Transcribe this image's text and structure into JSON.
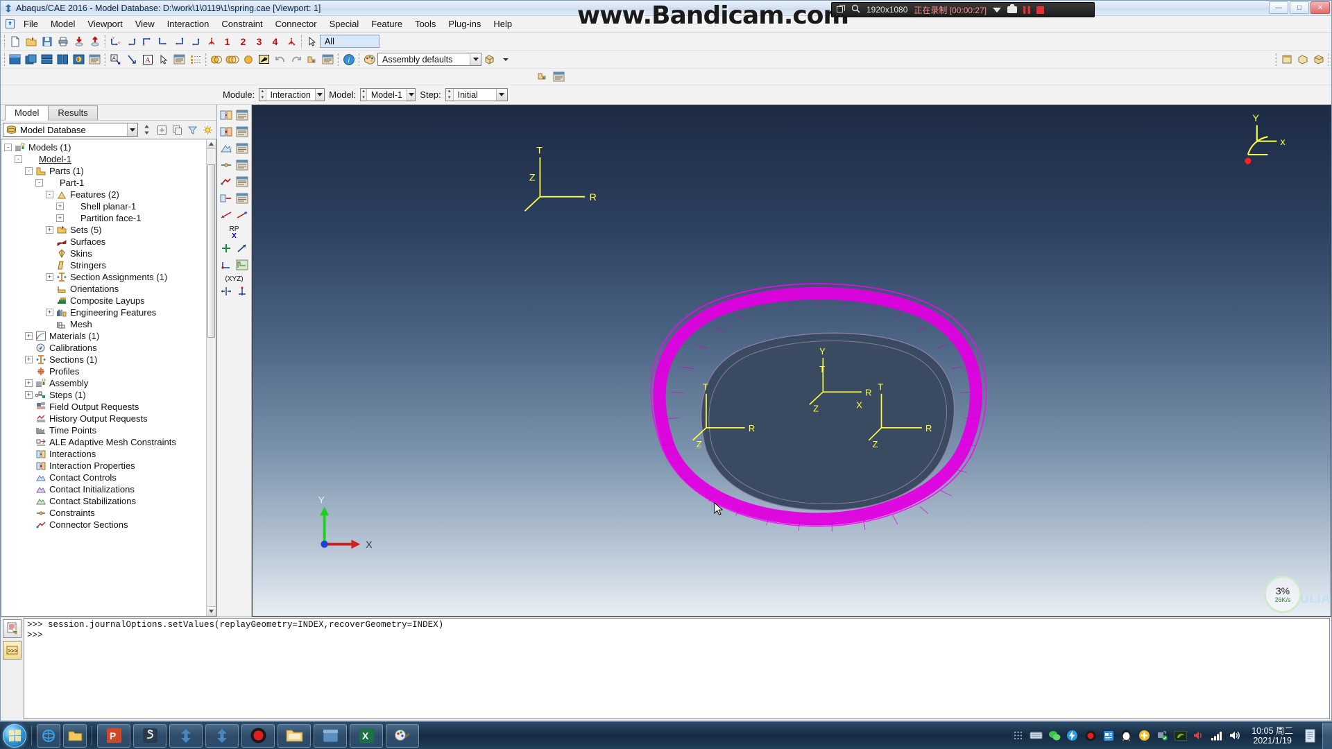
{
  "window": {
    "title": "Abaqus/CAE 2016 - Model Database: D:\\work\\1\\0119\\1\\spring.cae [Viewport: 1]",
    "minimize_label": "—",
    "maximize_label": "□",
    "close_label": "✕"
  },
  "watermark": {
    "text": "www.Bandicam.com"
  },
  "recorder": {
    "resolution": "1920x1080",
    "status": "正在录制 [00:00:27]",
    "expand_icon": "expand-icon",
    "zoom_icon": "magnifier-icon",
    "dropdown_icon": "chevron-down-icon",
    "camera_icon": "camera-icon",
    "pause_icon": "pause-icon",
    "stop_icon": "stop-icon"
  },
  "menubar": {
    "app_icon": "abaqus-menu-icon",
    "items": [
      "File",
      "Model",
      "Viewport",
      "View",
      "Interaction",
      "Constraint",
      "Connector",
      "Special",
      "Feature",
      "Tools",
      "Plug-ins",
      "Help"
    ]
  },
  "toolbar_row1": {
    "file_group": [
      "new-file-icon",
      "open-file-icon",
      "save-model-icon",
      "print-icon",
      "import-icon",
      "export-icon"
    ],
    "view_group": [
      "view-front-icon",
      "view-back-icon",
      "view-top-icon",
      "view-bottom-icon",
      "view-left-icon",
      "view-right-icon",
      "view-iso-icon"
    ],
    "view_numbers": [
      "1",
      "2",
      "3",
      "4"
    ],
    "apply_view_icon": "apply-view-icon",
    "selection_icon": "selection-arrow-icon",
    "selection_filter_value": "All"
  },
  "toolbar_row2": {
    "viewport_group": [
      "viewport-create-icon",
      "viewport-tile-icon",
      "viewport-horizontal-icon",
      "viewport-vertical-icon",
      "viewport-cycle-icon",
      "viewport-annotate-icon"
    ],
    "annotation_group": [
      "text-annotation-icon",
      "arrow-annotation-icon",
      "text-style-icon",
      "select-annotation-icon",
      "viewport-options-icon",
      "list-annotation-icon"
    ],
    "render_group": [
      "wireframe-icon",
      "hidden-line-icon",
      "shaded-icon",
      "render-beam-icon",
      "undo-view-icon",
      "redo-view-icon",
      "part-display-icon",
      "assembly-display-icon"
    ],
    "info_icon": "info-icon",
    "color_icon": "color-palette-icon",
    "color_code_value": "Assembly defaults",
    "cube_icon": "render-cube-icon",
    "right_group": [
      "plugin-1-icon",
      "plugin-2-icon",
      "plugin-3-icon"
    ]
  },
  "toolbar_row3": {
    "icons": [
      "query-icon",
      "probe-icon"
    ]
  },
  "context": {
    "module_label": "Module:",
    "module_value": "Interaction",
    "model_label": "Model:",
    "model_value": "Model-1",
    "step_label": "Step:",
    "step_value": "Initial"
  },
  "left_panel": {
    "tabs": [
      {
        "label": "Model",
        "active": true
      },
      {
        "label": "Results",
        "active": false
      }
    ],
    "database_selector": {
      "icon": "database-icon",
      "value": "Model Database"
    },
    "panel_buttons": [
      "spinner-icon",
      "create-icon",
      "copy-icon",
      "filter-icon",
      "highlight-icon"
    ],
    "tree": [
      {
        "label": "Models (1)",
        "indent": 0,
        "expander": "-",
        "icon": "models-icon"
      },
      {
        "label": "Model-1",
        "indent": 1,
        "expander": "-",
        "icon": "none",
        "underline": true
      },
      {
        "label": "Parts (1)",
        "indent": 2,
        "expander": "-",
        "icon": "parts-icon"
      },
      {
        "label": "Part-1",
        "indent": 3,
        "expander": "-",
        "icon": "none"
      },
      {
        "label": "Features (2)",
        "indent": 4,
        "expander": "-",
        "icon": "features-icon"
      },
      {
        "label": "Shell planar-1",
        "indent": 5,
        "expander": "+",
        "icon": "none"
      },
      {
        "label": "Partition face-1",
        "indent": 5,
        "expander": "+",
        "icon": "none"
      },
      {
        "label": "Sets (5)",
        "indent": 4,
        "expander": "+",
        "icon": "sets-icon"
      },
      {
        "label": "Surfaces",
        "indent": 4,
        "expander": "",
        "icon": "surfaces-icon"
      },
      {
        "label": "Skins",
        "indent": 4,
        "expander": "",
        "icon": "skins-icon"
      },
      {
        "label": "Stringers",
        "indent": 4,
        "expander": "",
        "icon": "stringers-icon"
      },
      {
        "label": "Section Assignments (1)",
        "indent": 4,
        "expander": "+",
        "icon": "section-assignments-icon"
      },
      {
        "label": "Orientations",
        "indent": 4,
        "expander": "",
        "icon": "orientations-icon"
      },
      {
        "label": "Composite Layups",
        "indent": 4,
        "expander": "",
        "icon": "composite-layups-icon"
      },
      {
        "label": "Engineering Features",
        "indent": 4,
        "expander": "+",
        "icon": "engineering-features-icon"
      },
      {
        "label": "Mesh",
        "indent": 4,
        "expander": "",
        "icon": "mesh-icon"
      },
      {
        "label": "Materials (1)",
        "indent": 2,
        "expander": "+",
        "icon": "materials-icon"
      },
      {
        "label": "Calibrations",
        "indent": 2,
        "expander": "",
        "icon": "calibrations-icon"
      },
      {
        "label": "Sections (1)",
        "indent": 2,
        "expander": "+",
        "icon": "sections-icon"
      },
      {
        "label": "Profiles",
        "indent": 2,
        "expander": "",
        "icon": "profiles-icon"
      },
      {
        "label": "Assembly",
        "indent": 2,
        "expander": "+",
        "icon": "assembly-icon"
      },
      {
        "label": "Steps (1)",
        "indent": 2,
        "expander": "+",
        "icon": "steps-icon"
      },
      {
        "label": "Field Output Requests",
        "indent": 2,
        "expander": "",
        "icon": "field-output-icon"
      },
      {
        "label": "History Output Requests",
        "indent": 2,
        "expander": "",
        "icon": "history-output-icon"
      },
      {
        "label": "Time Points",
        "indent": 2,
        "expander": "",
        "icon": "time-points-icon"
      },
      {
        "label": "ALE Adaptive Mesh Constraints",
        "indent": 2,
        "expander": "",
        "icon": "ale-icon"
      },
      {
        "label": "Interactions",
        "indent": 2,
        "expander": "",
        "icon": "interactions-icon"
      },
      {
        "label": "Interaction Properties",
        "indent": 2,
        "expander": "",
        "icon": "interaction-properties-icon"
      },
      {
        "label": "Contact Controls",
        "indent": 2,
        "expander": "",
        "icon": "contact-controls-icon"
      },
      {
        "label": "Contact Initializations",
        "indent": 2,
        "expander": "",
        "icon": "contact-init-icon"
      },
      {
        "label": "Contact Stabilizations",
        "indent": 2,
        "expander": "",
        "icon": "contact-stab-icon"
      },
      {
        "label": "Constraints",
        "indent": 2,
        "expander": "",
        "icon": "constraints-icon"
      },
      {
        "label": "Connector Sections",
        "indent": 2,
        "expander": "",
        "icon": "connector-sections-icon"
      }
    ]
  },
  "viewport_toolbar": {
    "label_rp": "RP",
    "label_x": "X",
    "label_xyz": "(XYZ)",
    "icons": [
      "create-interaction-icon",
      "interaction-manager-icon",
      "create-interaction-property-icon",
      "interaction-property-manager-icon",
      "create-contact-control-icon",
      "contact-control-manager-icon",
      "create-constraint-icon",
      "constraint-manager-icon",
      "create-connector-section-icon",
      "connector-section-manager-icon",
      "create-connector-assignment-icon",
      "connector-assignment-manager-icon",
      "create-wire-icon",
      "wire-manager-icon",
      "create-reference-point-icon",
      "reference-point-manager-icon",
      "create-datum-csys-icon",
      "datum-manager-icon",
      "create-set-icon",
      "set-manager-icon"
    ]
  },
  "viewport": {
    "triad_labels": {
      "x": "X",
      "y": "Y",
      "z": "Z"
    },
    "nav_triad_labels": {
      "x": "x",
      "y": "Y",
      "z": ""
    },
    "csys_labels": {
      "t": "T",
      "r": "R",
      "z": "Z"
    },
    "mesh_color": "#e000e0",
    "background_top": "#1d2b44",
    "background_bottom": "#e8eef4",
    "gauge_percent": "3%",
    "gauge_speed": "26K/s",
    "brand": "ULIA"
  },
  "message_area": {
    "tabs": [
      "message-area-icon",
      "command-line-icon"
    ],
    "lines": [
      ">>> session.journalOptions.setValues(replayGeometry=INDEX,recoverGeometry=INDEX)",
      ">>>"
    ]
  },
  "taskbar": {
    "start_icon": "start-orb-icon",
    "quick_launch": [
      "ie-icon",
      "folder-icon"
    ],
    "buttons": [
      "powerpoint-icon",
      "snipaste-icon",
      "abaqus-icon-1",
      "abaqus-icon-2",
      "record-icon",
      "explorer-icon",
      "window-icon",
      "excel-icon",
      "paint-icon"
    ],
    "tray_icons": [
      "show-hidden-icon",
      "keyboard-icon",
      "wechat-icon",
      "thunder-icon",
      "bandicam-tray-icon",
      "note-icon",
      "qq-icon",
      "plus-icon",
      "usb-safe-icon",
      "nvidia-icon",
      "volume-mute-icon",
      "signal-icon",
      "volume-icon"
    ],
    "clock_time": "10:05 周二",
    "clock_date": "2021/1/19",
    "action_center_icon": "action-center-icon",
    "show_desktop_icon": "show-desktop-icon"
  }
}
